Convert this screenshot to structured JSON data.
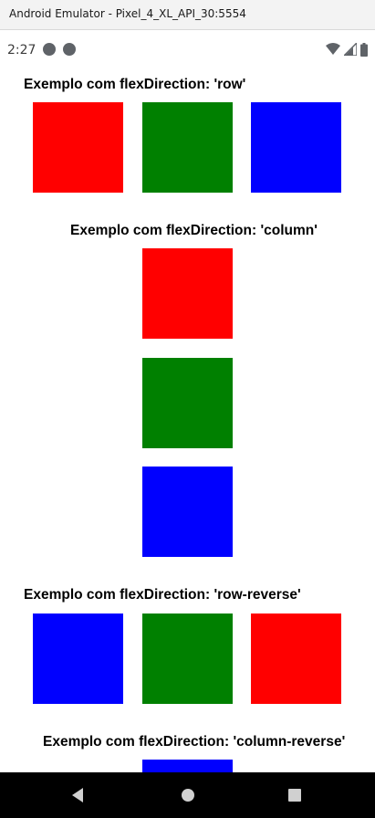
{
  "window": {
    "title": "Android Emulator - Pixel_4_XL_API_30:5554"
  },
  "status_bar": {
    "time": "2:27",
    "left_icons": [
      "expo-icon",
      "react-icon"
    ],
    "right_icons": [
      "wifi-icon",
      "signal-icon",
      "battery-icon"
    ]
  },
  "colors": {
    "red": "#ff0000",
    "green": "#008000",
    "blue": "#0000ff"
  },
  "sections": [
    {
      "heading": "Exemplo com flexDirection: 'row'",
      "boxes": [
        "red",
        "green",
        "blue"
      ]
    },
    {
      "heading": "Exemplo com flexDirection: 'column'",
      "boxes": [
        "red",
        "green",
        "blue"
      ]
    },
    {
      "heading": "Exemplo com flexDirection: 'row-reverse'",
      "boxes": [
        "blue",
        "green",
        "red"
      ]
    },
    {
      "heading": "Exemplo com flexDirection: 'column-reverse'",
      "boxes": [
        "blue"
      ]
    }
  ],
  "nav_bar": {
    "buttons": [
      "back-button",
      "home-button",
      "recents-button"
    ]
  }
}
